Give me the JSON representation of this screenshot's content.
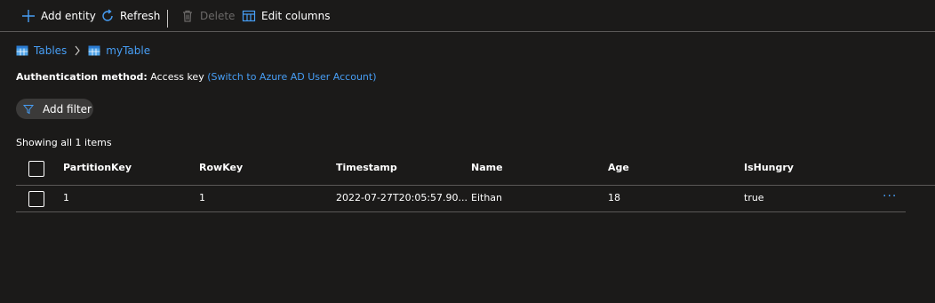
{
  "toolbar": {
    "add_entity": "Add entity",
    "refresh": "Refresh",
    "delete": "Delete",
    "edit_columns": "Edit columns"
  },
  "breadcrumb": {
    "tables": "Tables",
    "current": "myTable"
  },
  "auth": {
    "label": "Authentication method:",
    "value": "Access key",
    "switch_link": "(Switch to Azure AD User Account)"
  },
  "filter": {
    "add_filter": "Add filter"
  },
  "status": {
    "showing": "Showing all 1 items"
  },
  "table": {
    "columns": [
      "PartitionKey",
      "RowKey",
      "Timestamp",
      "Name",
      "Age",
      "IsHungry"
    ],
    "rows": [
      [
        "1",
        "1",
        "2022-07-27T20:05:57.90...",
        "Eithan",
        "18",
        "true"
      ]
    ],
    "row_actions": "···"
  },
  "colors": {
    "accent": "#479ef5",
    "background": "#1b1a19"
  }
}
